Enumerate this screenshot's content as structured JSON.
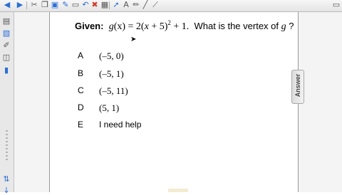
{
  "question": {
    "label": "Given:",
    "func_lhs": "g",
    "func_arg": "(x)",
    "equals": "= 2(",
    "x_var": "x",
    "plus5": " + 5)",
    "exponent": "2",
    "plus1": " + 1.",
    "prompt_pre": "What is the vertex of ",
    "prompt_var": "g",
    "prompt_post": " ?"
  },
  "choices": [
    {
      "letter": "A",
      "text": "(–5, 0)"
    },
    {
      "letter": "B",
      "text": "(–5, 1)"
    },
    {
      "letter": "C",
      "text": "(–5, 11)"
    },
    {
      "letter": "D",
      "text": "(5, 1)"
    },
    {
      "letter": "E",
      "text": "I need help"
    }
  ],
  "answer_tab": {
    "label": "Answer"
  },
  "toolbar_icons": [
    "back-icon",
    "forward-icon",
    "cut-icon",
    "copy-icon",
    "paste-icon",
    "pen-icon",
    "eraser-icon",
    "undo-icon",
    "delete-icon",
    "table-icon",
    "cursor-icon",
    "text-icon",
    "pencil-icon",
    "shape-icon",
    "screen-icon"
  ],
  "colors": {
    "accent": "#2b6fd6",
    "delete": "#d23b2b",
    "toolbar": "#e4e4e4"
  }
}
